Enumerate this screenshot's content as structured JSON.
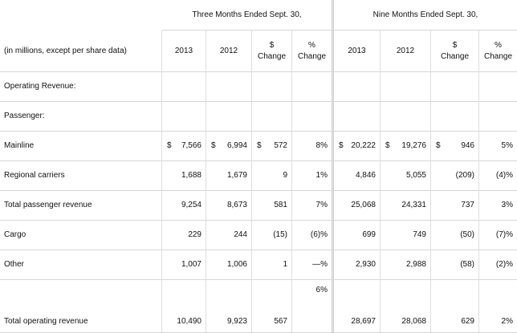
{
  "header": {
    "group_three": "Three Months Ended Sept. 30,",
    "group_nine": "Nine Months Ended Sept. 30,",
    "label_col": "(in millions, except per share data)",
    "col_2013": "2013",
    "col_2012": "2012",
    "dollar_change_line1": "$",
    "dollar_change_line2": "Change",
    "pct_change_line1": "%",
    "pct_change_line2": "Change"
  },
  "rows": [
    {
      "label": "Operating Revenue:",
      "three": [
        "",
        "",
        "",
        ""
      ],
      "nine": [
        "",
        "",
        "",
        ""
      ]
    },
    {
      "label": "Passenger:",
      "three": [
        "",
        "",
        "",
        ""
      ],
      "nine": [
        "",
        "",
        "",
        ""
      ]
    },
    {
      "label": "Mainline",
      "three": [
        "7,566",
        "6,994",
        "572",
        "8%"
      ],
      "nine": [
        "20,222",
        "19,276",
        "946",
        "5%"
      ],
      "dollar_sign": "$"
    },
    {
      "label": "Regional carriers",
      "three": [
        "1,688",
        "1,679",
        "9",
        "1%"
      ],
      "nine": [
        "4,846",
        "5,055",
        "(209)",
        "(4)%"
      ]
    },
    {
      "label": "Total passenger revenue",
      "three": [
        "9,254",
        "8,673",
        "581",
        "7%"
      ],
      "nine": [
        "25,068",
        "24,331",
        "737",
        "3%"
      ]
    },
    {
      "label": "Cargo",
      "three": [
        "229",
        "244",
        "(15)",
        "(6)%"
      ],
      "nine": [
        "699",
        "749",
        "(50)",
        "(7)%"
      ]
    },
    {
      "label": "Other",
      "three": [
        "1,007",
        "1,006",
        "1",
        "—%"
      ],
      "nine": [
        "2,930",
        "2,988",
        "(58)",
        "(2)%"
      ]
    },
    {
      "label": "Total operating revenue",
      "three": [
        "10,490",
        "9,923",
        "567",
        "6%"
      ],
      "nine": [
        "28,697",
        "28,068",
        "629",
        "2%"
      ]
    }
  ]
}
